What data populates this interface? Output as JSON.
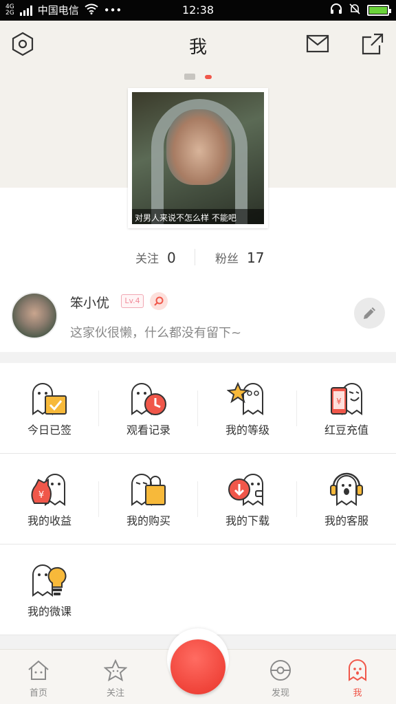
{
  "status_bar": {
    "network": "4G\n2G",
    "carrier": "中国电信",
    "more": "•••",
    "time": "12:38"
  },
  "header": {
    "title": "我",
    "settings_icon": "hexagon-settings-icon",
    "mail_icon": "mail-icon",
    "share_icon": "share-icon"
  },
  "cover": {
    "caption": "对男人来说不怎么样 不能吧"
  },
  "stats": {
    "following_label": "关注",
    "following_count": "0",
    "fans_label": "粉丝",
    "fans_count": "17"
  },
  "profile": {
    "username": "笨小优",
    "level": "Lv.4",
    "bio": "这家伙很懒，什么都没有留下~"
  },
  "menu": {
    "row1": [
      {
        "label": "今日已签",
        "icon": "checkin-ghost-icon"
      },
      {
        "label": "观看记录",
        "icon": "history-ghost-icon"
      },
      {
        "label": "我的等级",
        "icon": "level-ghost-icon"
      },
      {
        "label": "红豆充值",
        "icon": "recharge-ghost-icon"
      }
    ],
    "row2": [
      {
        "label": "我的收益",
        "icon": "earnings-ghost-icon"
      },
      {
        "label": "我的购买",
        "icon": "purchase-ghost-icon"
      },
      {
        "label": "我的下载",
        "icon": "download-ghost-icon"
      },
      {
        "label": "我的客服",
        "icon": "service-ghost-icon"
      }
    ],
    "row3": [
      {
        "label": "我的微课",
        "icon": "microclass-ghost-icon"
      }
    ]
  },
  "bottom_nav": {
    "home": "首页",
    "follow": "关注",
    "discover": "发现",
    "me": "我"
  },
  "colors": {
    "accent": "#f0574a",
    "header_bg": "#f3f1ec",
    "gold": "#f7b93a"
  }
}
